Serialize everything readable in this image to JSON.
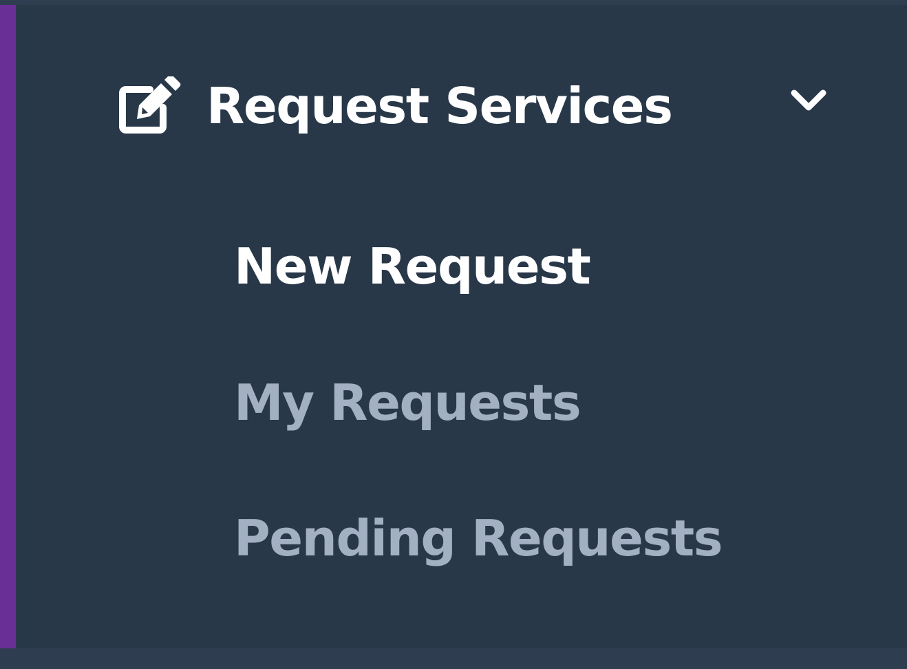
{
  "nav": {
    "group": {
      "title": "Request Services",
      "icon": "edit-icon",
      "toggle_icon": "chevron-down-icon",
      "expanded": true
    },
    "items": [
      {
        "label": "New Request",
        "active": true
      },
      {
        "label": "My Requests",
        "active": false
      },
      {
        "label": "Pending Requests",
        "active": false
      }
    ]
  },
  "colors": {
    "accent": "#6a2f96",
    "panel_background": "#283849",
    "active_text": "#ffffff",
    "inactive_text": "#a3afc2"
  }
}
